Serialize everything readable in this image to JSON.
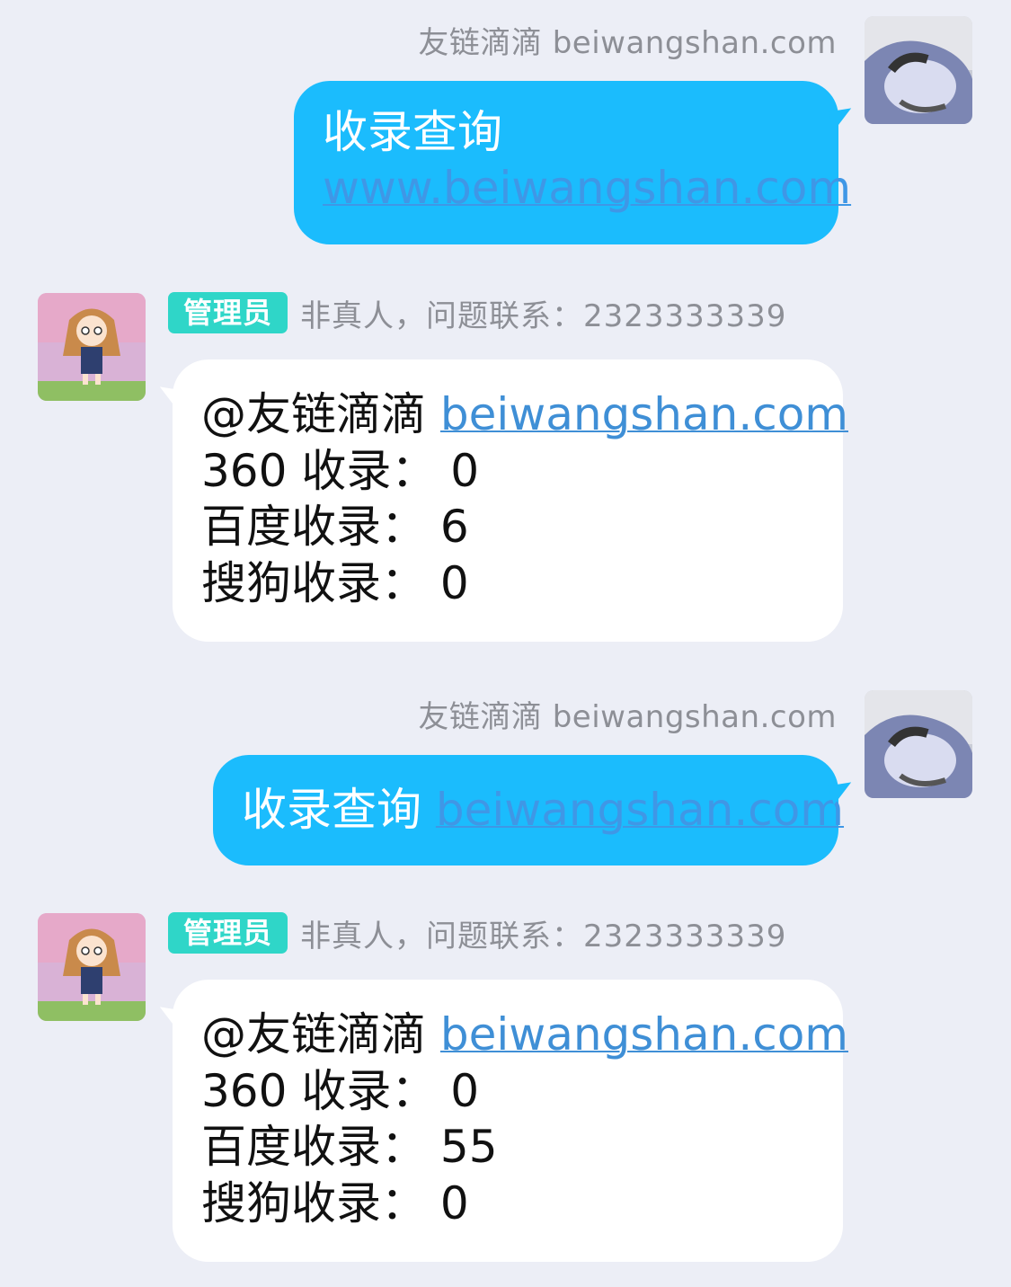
{
  "colors": {
    "background": "#eceef6",
    "outgoing_bubble": "#1bbcfd",
    "incoming_bubble": "#ffffff",
    "admin_badge": "#2fd6c8",
    "link": "#3f8fd6",
    "meta_text": "#8d8f96"
  },
  "messages": [
    {
      "direction": "outgoing",
      "sender": "友链滴滴 beiwangshan.com",
      "avatar": "user-photo-avatar",
      "text": "收录查询",
      "link": "www.beiwangshan.com"
    },
    {
      "direction": "incoming",
      "badge": "管理员",
      "status": "非真人，问题联系：2323333339",
      "avatar": "anime-girl-avatar",
      "mention": "@友链滴滴",
      "link": "beiwangshan.com",
      "lines": [
        "360 收录： 0",
        "百度收录： 6",
        "搜狗收录： 0"
      ]
    },
    {
      "direction": "outgoing",
      "sender": "友链滴滴 beiwangshan.com",
      "avatar": "user-photo-avatar",
      "text": "收录查询",
      "link": "beiwangshan.com"
    },
    {
      "direction": "incoming",
      "badge": "管理员",
      "status": "非真人，问题联系：2323333339",
      "avatar": "anime-girl-avatar",
      "mention": "@友链滴滴",
      "link": "beiwangshan.com",
      "lines": [
        "360 收录： 0",
        "百度收录： 55",
        "搜狗收录： 0"
      ]
    }
  ]
}
